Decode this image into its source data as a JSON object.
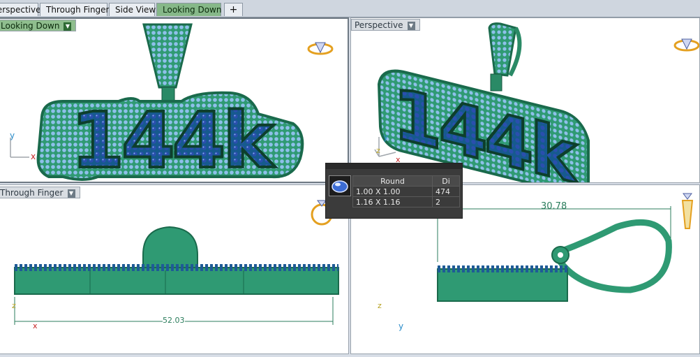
{
  "tabs": [
    {
      "label": "Perspective",
      "active": false
    },
    {
      "label": "Through Finger",
      "active": false
    },
    {
      "label": "Side View",
      "active": false
    },
    {
      "label": "Looking Down",
      "active": true
    },
    {
      "label": "+",
      "active": false
    }
  ],
  "viewports": {
    "top_left": {
      "label": "Looking Down",
      "axis_x": "x",
      "axis_y": "y",
      "text": "144k"
    },
    "top_right": {
      "label": "Perspective",
      "axis_x": "x",
      "axis_y": "y",
      "axis_z": "z",
      "text": "144k"
    },
    "bottom_left": {
      "label": "Through Finger",
      "axis_x": "x",
      "axis_z": "z",
      "dimension": "52.03"
    },
    "bottom_right": {
      "axis_y": "y",
      "axis_z": "z",
      "dimension": "30.78"
    }
  },
  "stone_popup": {
    "columns": [
      "Round",
      "Di"
    ],
    "rows": [
      {
        "size": "1.00 X 1.00",
        "count": "474"
      },
      {
        "size": "1.16 X 1.16",
        "count": "2"
      }
    ]
  },
  "colors": {
    "metal": "#2f9a73",
    "metal_dark": "#1a6a4c",
    "stones": "#7fb3e6",
    "stones_dark": "#1e3d8f",
    "active_tab": "#86b889",
    "dimension_line": "#2b7d5c"
  }
}
